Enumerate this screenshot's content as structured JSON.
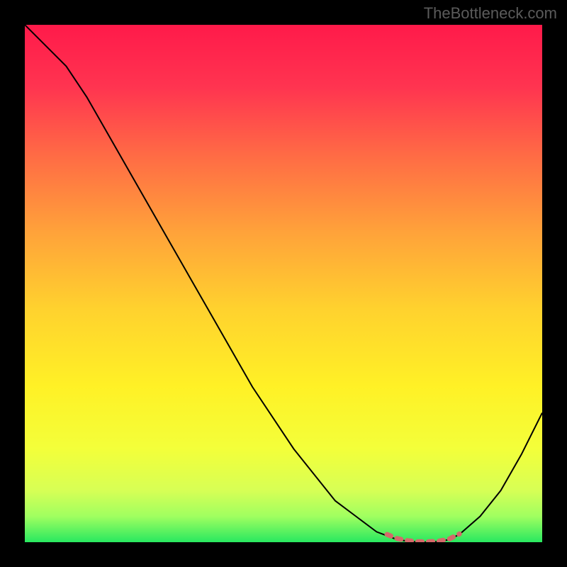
{
  "watermark": "TheBottleneck.com",
  "chart_data": {
    "type": "line",
    "title": "",
    "xlabel": "",
    "ylabel": "",
    "xlim": [
      0,
      100
    ],
    "ylim": [
      0,
      100
    ],
    "series": [
      {
        "name": "bottleneck-curve",
        "color": "#000000",
        "x": [
          0,
          4,
          8,
          12,
          16,
          20,
          24,
          28,
          32,
          36,
          40,
          44,
          48,
          52,
          56,
          60,
          64,
          68,
          72,
          74,
          76,
          78,
          80,
          82,
          84,
          88,
          92,
          96,
          100
        ],
        "y": [
          100,
          96,
          92,
          86,
          79,
          72,
          65,
          58,
          51,
          44,
          37,
          30,
          24,
          18,
          13,
          8,
          5,
          2,
          0.5,
          0.2,
          0,
          0,
          0.1,
          0.5,
          1.5,
          5,
          10,
          17,
          25
        ]
      },
      {
        "name": "optimal-range-highlight",
        "color": "#d46a6a",
        "thickness": "thick",
        "x": [
          70,
          72,
          74,
          76,
          78,
          80,
          82,
          84
        ],
        "y": [
          1.5,
          0.7,
          0.3,
          0.1,
          0.1,
          0.2,
          0.6,
          1.6
        ]
      }
    ],
    "background_gradient": {
      "type": "vertical",
      "stops": [
        {
          "pos": 0.0,
          "color": "#ff1a4a"
        },
        {
          "pos": 0.12,
          "color": "#ff3450"
        },
        {
          "pos": 0.25,
          "color": "#ff6a45"
        },
        {
          "pos": 0.4,
          "color": "#ffa23a"
        },
        {
          "pos": 0.55,
          "color": "#ffd22e"
        },
        {
          "pos": 0.7,
          "color": "#fff126"
        },
        {
          "pos": 0.82,
          "color": "#f3ff3a"
        },
        {
          "pos": 0.9,
          "color": "#d7ff55"
        },
        {
          "pos": 0.95,
          "color": "#a0ff60"
        },
        {
          "pos": 1.0,
          "color": "#28e860"
        }
      ]
    }
  }
}
